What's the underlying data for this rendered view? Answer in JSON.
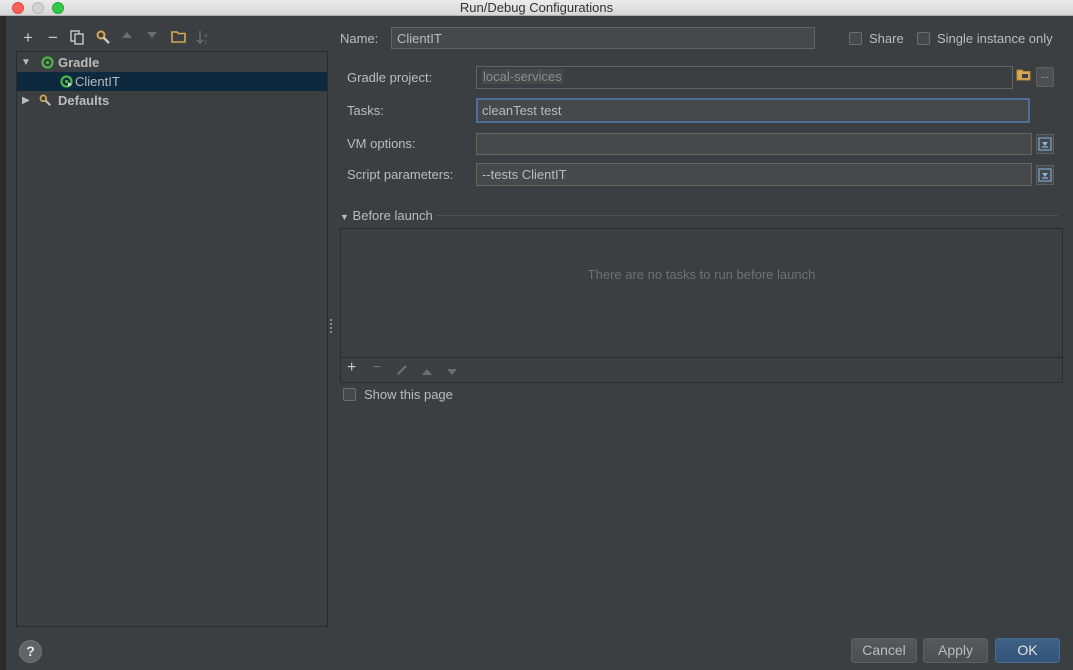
{
  "window": {
    "title": "Run/Debug Configurations"
  },
  "toolbar": {
    "icons": [
      "add-icon",
      "remove-icon",
      "copy-icon",
      "wrench-icon",
      "move-up-icon",
      "move-down-icon",
      "folder-icon",
      "sort-icon"
    ],
    "add": "+",
    "remove": "−"
  },
  "tree": {
    "items": [
      {
        "label": "Gradle",
        "icon": "gradle-icon",
        "expanded": true
      },
      {
        "label": "ClientIT",
        "icon": "gradle-config-icon",
        "selected": true
      },
      {
        "label": "Defaults",
        "icon": "wrench-icon",
        "expanded": false
      }
    ]
  },
  "form": {
    "name_label": "Name:",
    "name_value": "ClientIT",
    "share_label": "Share",
    "single_instance_label": "Single instance only",
    "gradle_project_label": "Gradle project:",
    "gradle_project_value": "local-services",
    "browse_label": "...",
    "tasks_label": "Tasks:",
    "tasks_value": "cleanTest test",
    "vm_options_label": "VM options:",
    "vm_options_value": "",
    "script_params_label": "Script parameters:",
    "script_params_value": "--tests ClientIT"
  },
  "before_launch": {
    "title": "Before launch",
    "empty_text": "There are no tasks to run before launch",
    "add": "+",
    "remove": "−"
  },
  "show_page_label": "Show this page",
  "buttons": {
    "help": "?",
    "cancel": "Cancel",
    "apply": "Apply",
    "ok": "OK"
  },
  "colors": {
    "background": "#3c3f41",
    "selection": "#0d293e",
    "focus_border": "#4d6e96",
    "default_button": "#365880",
    "gradle_green": "#4fb548"
  }
}
